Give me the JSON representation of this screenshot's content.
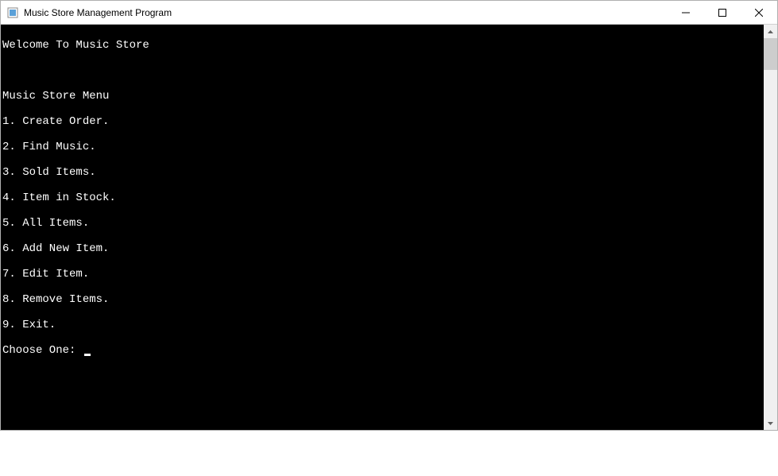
{
  "window": {
    "title": "Music Store Management Program"
  },
  "console": {
    "welcome": "Welcome To Music Store",
    "blank": " ",
    "menu_title": "Music Store Menu",
    "items": [
      "1. Create Order.",
      "2. Find Music.",
      "3. Sold Items.",
      "4. Item in Stock.",
      "5. All Items.",
      "6. Add New Item.",
      "7. Edit Item.",
      "8. Remove Items.",
      "9. Exit."
    ],
    "prompt": "Choose One: "
  }
}
